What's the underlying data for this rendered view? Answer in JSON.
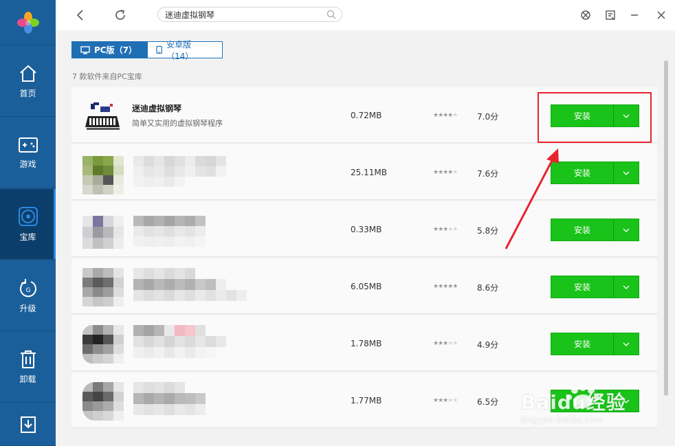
{
  "search": {
    "value": "迷迪虚拟钢琴"
  },
  "sidebar": {
    "items": [
      {
        "label": "首页",
        "icon": "home-icon"
      },
      {
        "label": "游戏",
        "icon": "gamepad-icon"
      },
      {
        "label": "宝库",
        "icon": "disc-icon",
        "active": true
      },
      {
        "label": "升级",
        "icon": "upgrade-icon"
      },
      {
        "label": "卸载",
        "icon": "trash-icon"
      },
      {
        "label": "",
        "icon": "download-icon"
      }
    ]
  },
  "tabs": [
    {
      "label": "PC版（7）",
      "active": true,
      "icon": "monitor-icon"
    },
    {
      "label": "安卓版（14）",
      "active": false,
      "icon": "phone-icon"
    }
  ],
  "source_text": "7 款软件来自PC宝库",
  "install_label": "安装",
  "apps": [
    {
      "name": "迷迪虚拟钢琴",
      "desc": "简单又实用的虚拟钢琴程序",
      "size": "0.72MB",
      "rating": 3.5,
      "score": "7.0分"
    },
    {
      "name": "",
      "desc": "",
      "size": "25.11MB",
      "rating": 3.5,
      "score": "7.6分"
    },
    {
      "name": "",
      "desc": "",
      "size": "0.33MB",
      "rating": 2.5,
      "score": "5.8分"
    },
    {
      "name": "",
      "desc": "",
      "size": "6.05MB",
      "rating": 4.5,
      "score": "8.6分"
    },
    {
      "name": "",
      "desc": "",
      "size": "1.78MB",
      "rating": 2.5,
      "score": "4.9分"
    },
    {
      "name": "",
      "desc": "",
      "size": "1.77MB",
      "rating": 3,
      "score": "6.5分"
    }
  ],
  "watermark": {
    "brand": "Baidu经验",
    "url": "jingyan.baidu.com"
  },
  "colors": {
    "sidebar": "#1b5f9a",
    "accent": "#1f6fb5",
    "install": "#19c319",
    "highlight": "#e8232e"
  }
}
